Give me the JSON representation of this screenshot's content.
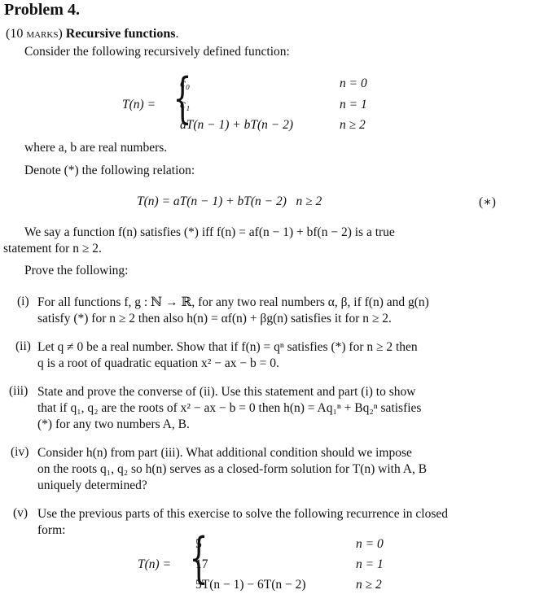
{
  "problem": {
    "title": "Problem 4.",
    "marks": "(10 marks)",
    "heading": "Recursive functions",
    "intro": "Consider the following recursively defined function:"
  },
  "definition": {
    "lhs": "T(n) =",
    "cases": [
      {
        "expr": "c₀",
        "cond": "n = 0"
      },
      {
        "expr": "c₁",
        "cond": "n = 1"
      },
      {
        "expr": "aT(n − 1) + bT(n − 2)",
        "cond": "n ≥ 2"
      }
    ],
    "where": "where a, b are real numbers.",
    "denote": "Denote (*) the following relation:",
    "relation": "T(n) = aT(n − 1) + bT(n − 2)   n ≥ 2",
    "relation_tag": "(∗)",
    "satisfies_line1": "We say a function f(n) satisfies (*) iff f(n) = af(n − 1) + bf(n − 2) is a true",
    "satisfies_line2": "statement for n ≥ 2.",
    "prove": "Prove the following:"
  },
  "items": [
    {
      "label": "(i)",
      "lines": [
        "For all functions f, g : ℕ → ℝ, for any two real numbers α, β, if f(n) and g(n)",
        "satisfy (*) for n ≥ 2 then also h(n) = αf(n) + βg(n) satisfies it for n ≥ 2."
      ]
    },
    {
      "label": "(ii)",
      "lines": [
        "Let q ≠ 0 be a real number. Show that if f(n) = qⁿ satisfies (*) for n ≥ 2 then",
        "q is a root of quadratic equation x² − ax − b = 0."
      ]
    },
    {
      "label": "(iii)",
      "lines": [
        "State and prove the converse of (ii). Use this statement and part (i) to show",
        "that if q₁, q₂ are the roots of x² − ax − b = 0 then h(n) = Aq₁ⁿ + Bq₂ⁿ satisfies",
        "(*) for any two numbers A, B."
      ]
    },
    {
      "label": "(iv)",
      "lines": [
        "Consider h(n) from part (iii). What additional condition should we impose",
        "on the roots q₁, q₂ so h(n) serves as a closed-form solution for T(n) with A, B",
        "uniquely determined?"
      ]
    },
    {
      "label": "(v)",
      "lines": [
        "Use the previous parts of this exercise to solve the following recurrence in closed",
        "form:"
      ]
    }
  ],
  "final_recurrence": {
    "lhs": "T(n) =",
    "cases": [
      {
        "expr": "5",
        "cond": "n = 0"
      },
      {
        "expr": "17",
        "cond": "n = 1"
      },
      {
        "expr": "5T(n − 1) − 6T(n − 2)",
        "cond": "n ≥ 2"
      }
    ]
  }
}
